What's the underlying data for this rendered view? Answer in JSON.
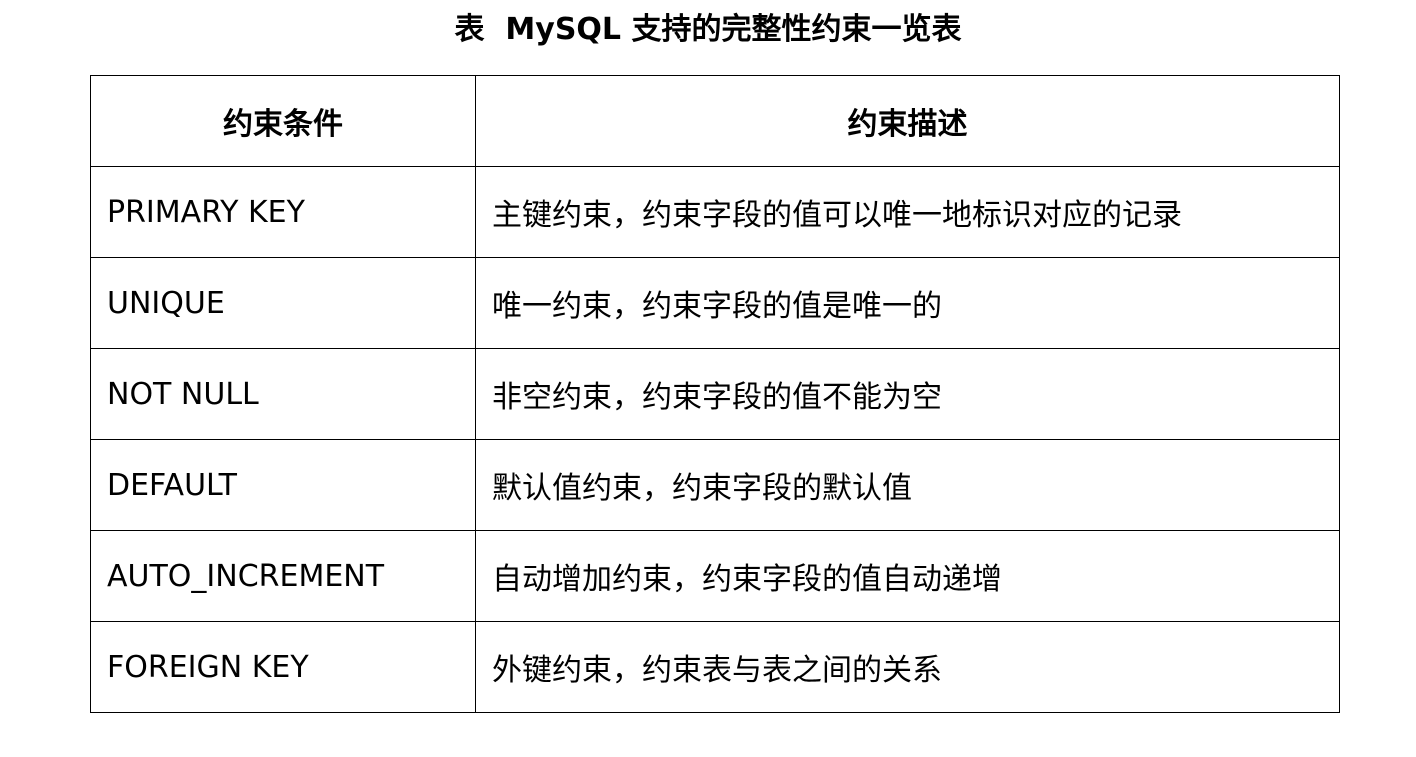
{
  "title": "表  MySQL 支持的完整性约束一览表",
  "table": {
    "headers": [
      "约束条件",
      "约束描述"
    ],
    "rows": [
      {
        "condition": "PRIMARY KEY",
        "description": "主键约束，约束字段的值可以唯一地标识对应的记录"
      },
      {
        "condition": "UNIQUE",
        "description": "唯一约束，约束字段的值是唯一的"
      },
      {
        "condition": "NOT NULL",
        "description": "非空约束，约束字段的值不能为空"
      },
      {
        "condition": "DEFAULT",
        "description": "默认值约束，约束字段的默认值"
      },
      {
        "condition": "AUTO_INCREMENT",
        "description": "自动增加约束，约束字段的值自动递增"
      },
      {
        "condition": "FOREIGN KEY",
        "description": "外键约束，约束表与表之间的关系"
      }
    ]
  }
}
